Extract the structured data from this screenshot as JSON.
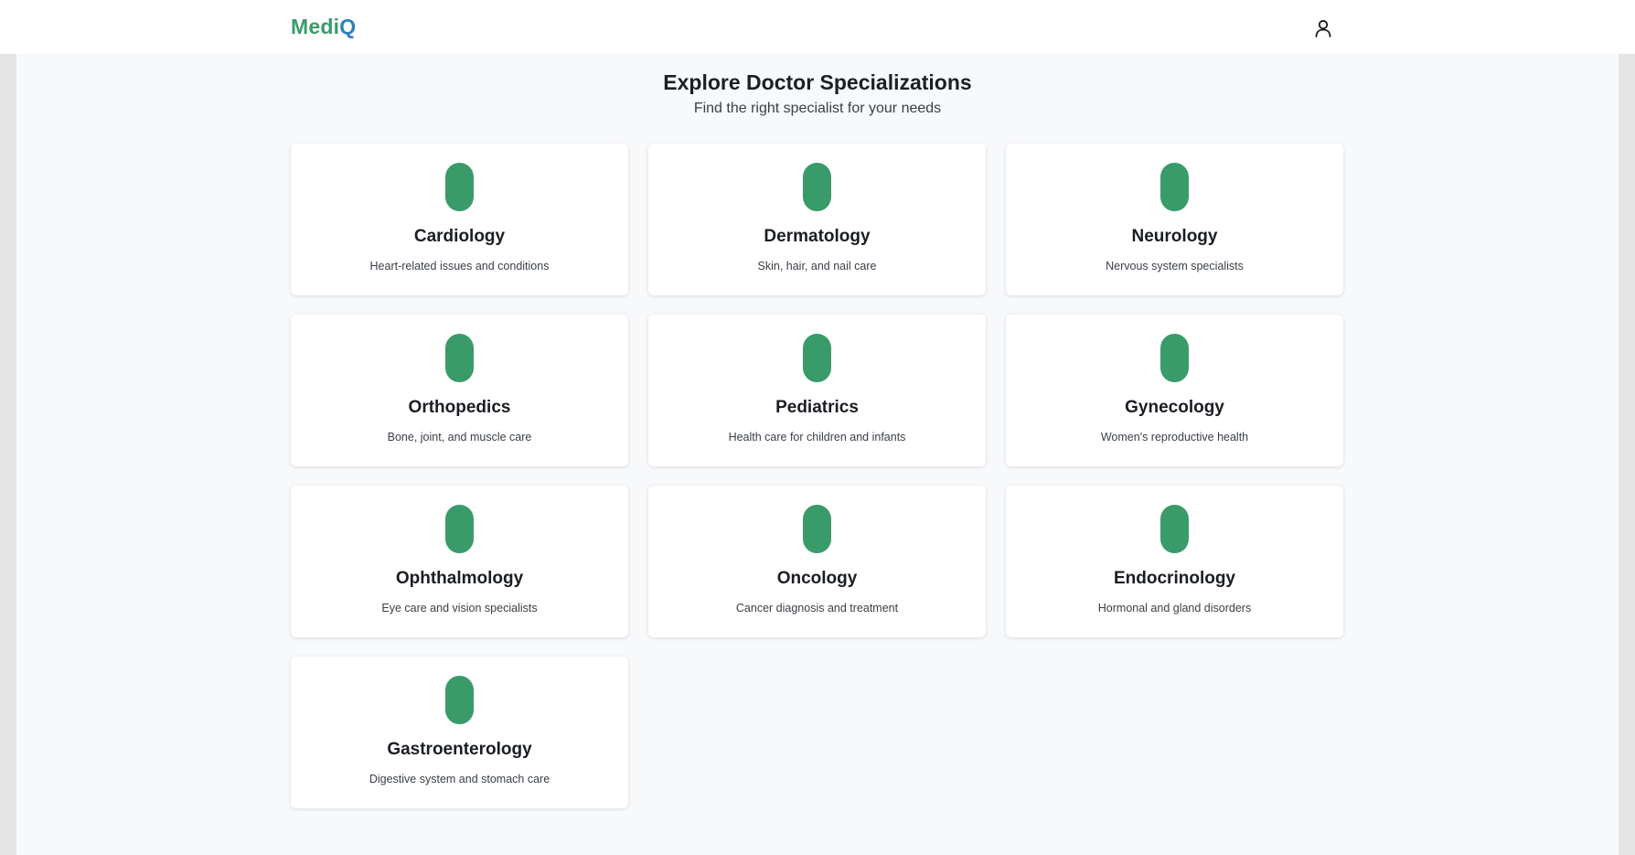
{
  "navbar": {
    "logo_part1": "Medi",
    "logo_part2": "Q",
    "user_icon": "user-icon"
  },
  "header": {
    "title": "Explore Doctor Specializations",
    "subtitle": "Find the right specialist for your needs"
  },
  "colors": {
    "brand_green": "#3a9b6a",
    "brand_blue": "#2f7fc1"
  },
  "specializations": [
    {
      "name": "Cardiology",
      "description": "Heart-related issues and conditions",
      "icon": "capsule-icon"
    },
    {
      "name": "Dermatology",
      "description": "Skin, hair, and nail care",
      "icon": "capsule-icon"
    },
    {
      "name": "Neurology",
      "description": "Nervous system specialists",
      "icon": "capsule-icon"
    },
    {
      "name": "Orthopedics",
      "description": "Bone, joint, and muscle care",
      "icon": "capsule-icon"
    },
    {
      "name": "Pediatrics",
      "description": "Health care for children and infants",
      "icon": "capsule-icon"
    },
    {
      "name": "Gynecology",
      "description": "Women's reproductive health",
      "icon": "capsule-icon"
    },
    {
      "name": "Ophthalmology",
      "description": "Eye care and vision specialists",
      "icon": "capsule-icon"
    },
    {
      "name": "Oncology",
      "description": "Cancer diagnosis and treatment",
      "icon": "capsule-icon"
    },
    {
      "name": "Endocrinology",
      "description": "Hormonal and gland disorders",
      "icon": "capsule-icon"
    },
    {
      "name": "Gastroenterology",
      "description": "Digestive system and stomach care",
      "icon": "capsule-icon"
    }
  ]
}
